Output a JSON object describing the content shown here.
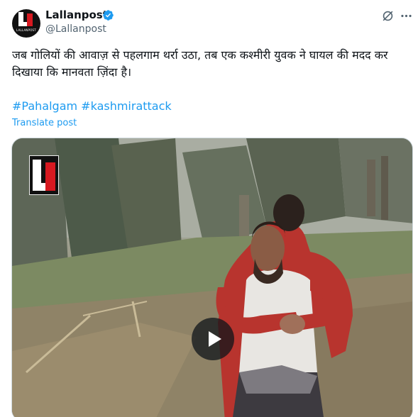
{
  "author": {
    "display_name": "Lallanpost",
    "handle": "@Lallanpost",
    "avatar_text": "LALLANPOST",
    "verified": true,
    "verified_color": "#1d9bf0"
  },
  "post": {
    "text": "जब गोलियों की आवाज़ से पहलगाम थर्रा उठा, तब एक कश्मीरी युवक ने घायल की मदद कर दिखाया कि मानवता ज़िंदा है।",
    "hashtags": [
      "#Pahalgam",
      "#kashmirattack"
    ],
    "translate_label": "Translate post"
  },
  "media": {
    "type": "video",
    "play_icon": "play-icon"
  },
  "header_icons": {
    "grok": "grok-icon",
    "more": "more-icon"
  },
  "colors": {
    "link": "#1d9bf0",
    "text": "#0f1419",
    "secondary": "#536471",
    "brand_red": "#d71920"
  }
}
